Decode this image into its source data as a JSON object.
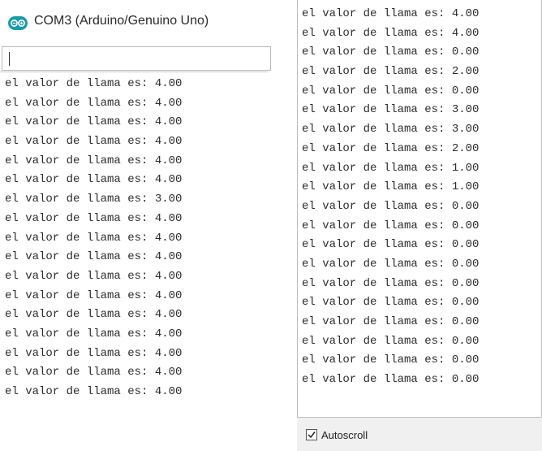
{
  "left_window": {
    "title": "COM3 (Arduino/Genuino Uno)",
    "app_icon": "arduino-logo-icon",
    "send_input": {
      "value": ""
    },
    "lines": [
      "el valor de llama es: 4.00",
      "el valor de llama es: 4.00",
      "el valor de llama es: 4.00",
      "el valor de llama es: 4.00",
      "el valor de llama es: 4.00",
      "el valor de llama es: 4.00",
      "el valor de llama es: 3.00",
      "el valor de llama es: 4.00",
      "el valor de llama es: 4.00",
      "el valor de llama es: 4.00",
      "el valor de llama es: 4.00",
      "el valor de llama es: 4.00",
      "el valor de llama es: 4.00",
      "el valor de llama es: 4.00",
      "el valor de llama es: 4.00",
      "el valor de llama es: 4.00",
      "el valor de llama es: 4.00"
    ]
  },
  "right_panel": {
    "lines": [
      "el valor de llama es: 4.00",
      "el valor de llama es: 4.00",
      "el valor de llama es: 0.00",
      "el valor de llama es: 2.00",
      "el valor de llama es: 0.00",
      "el valor de llama es: 3.00",
      "el valor de llama es: 3.00",
      "el valor de llama es: 2.00",
      "el valor de llama es: 1.00",
      "el valor de llama es: 1.00",
      "el valor de llama es: 0.00",
      "el valor de llama es: 0.00",
      "el valor de llama es: 0.00",
      "el valor de llama es: 0.00",
      "el valor de llama es: 0.00",
      "el valor de llama es: 0.00",
      "el valor de llama es: 0.00",
      "el valor de llama es: 0.00",
      "el valor de llama es: 0.00",
      "el valor de llama es: 0.00"
    ],
    "autoscroll": {
      "label": "Autoscroll",
      "checked": true
    }
  },
  "colors": {
    "arduino_teal": "#1e9aa4",
    "statusbar_bg": "#f0f0f0"
  }
}
